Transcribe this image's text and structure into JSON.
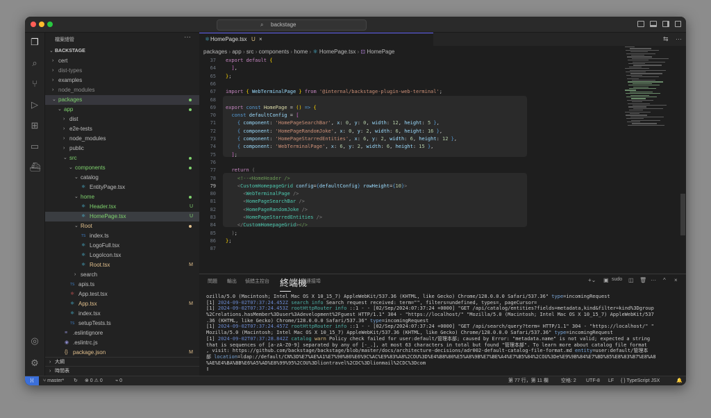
{
  "window": {
    "search_text": "backstage"
  },
  "sidebar": {
    "header": "檔案總管",
    "root": "BACKSTAGE",
    "tree": [
      {
        "label": "cert",
        "depth": 0,
        "chev": "›",
        "icon": "",
        "color": "#bdbdbd"
      },
      {
        "label": "dist-types",
        "depth": 0,
        "chev": "›",
        "icon": "",
        "color": "#8a8a8a"
      },
      {
        "label": "examples",
        "depth": 0,
        "chev": "›",
        "icon": "",
        "color": "#bdbdbd"
      },
      {
        "label": "node_modules",
        "depth": 0,
        "chev": "›",
        "icon": "",
        "color": "#8a8a8a"
      },
      {
        "label": "packages",
        "depth": 0,
        "chev": "⌄",
        "icon": "",
        "color": "#7fd26e",
        "dot": "#7fd26e",
        "selrow": true
      },
      {
        "label": "app",
        "depth": 1,
        "chev": "⌄",
        "icon": "",
        "color": "#7fd26e",
        "dot": "#7fd26e"
      },
      {
        "label": "dist",
        "depth": 2,
        "chev": "›",
        "icon": "",
        "color": "#bdbdbd"
      },
      {
        "label": "e2e-tests",
        "depth": 2,
        "chev": "›",
        "icon": "",
        "color": "#bdbdbd"
      },
      {
        "label": "node_modules",
        "depth": 2,
        "chev": "›",
        "icon": "",
        "color": "#bdbdbd"
      },
      {
        "label": "public",
        "depth": 2,
        "chev": "›",
        "icon": "",
        "color": "#bdbdbd"
      },
      {
        "label": "src",
        "depth": 2,
        "chev": "⌄",
        "icon": "",
        "color": "#7fd26e",
        "dot": "#7fd26e"
      },
      {
        "label": "components",
        "depth": 3,
        "chev": "⌄",
        "icon": "",
        "color": "#7fd26e",
        "dot": "#7fd26e"
      },
      {
        "label": "catalog",
        "depth": 4,
        "chev": "⌄",
        "icon": "",
        "color": "#bdbdbd"
      },
      {
        "label": "EntityPage.tsx",
        "depth": 5,
        "chev": "",
        "icon": "⚛",
        "iconColor": "#4ec1e0",
        "color": "#bdbdbd"
      },
      {
        "label": "home",
        "depth": 4,
        "chev": "⌄",
        "icon": "",
        "color": "#7fd26e",
        "dot": "#7fd26e"
      },
      {
        "label": "Header.tsx",
        "depth": 5,
        "chev": "",
        "icon": "⚛",
        "iconColor": "#4ec1e0",
        "color": "#7fd26e",
        "badge": "U",
        "badgeColor": "#7fd26e"
      },
      {
        "label": "HomePage.tsx",
        "depth": 5,
        "chev": "",
        "icon": "⚛",
        "iconColor": "#4ec1e0",
        "color": "#7fd26e",
        "badge": "U",
        "badgeColor": "#7fd26e",
        "selected": true
      },
      {
        "label": "Root",
        "depth": 4,
        "chev": "⌄",
        "icon": "",
        "color": "#e2c08d",
        "dot": "#e2c08d"
      },
      {
        "label": "index.ts",
        "depth": 5,
        "chev": "",
        "icon": "TS",
        "iconColor": "#3f7fc6",
        "color": "#bdbdbd"
      },
      {
        "label": "LogoFull.tsx",
        "depth": 5,
        "chev": "",
        "icon": "⚛",
        "iconColor": "#4ec1e0",
        "color": "#bdbdbd"
      },
      {
        "label": "LogoIcon.tsx",
        "depth": 5,
        "chev": "",
        "icon": "⚛",
        "iconColor": "#4ec1e0",
        "color": "#bdbdbd"
      },
      {
        "label": "Root.tsx",
        "depth": 5,
        "chev": "",
        "icon": "⚛",
        "iconColor": "#4ec1e0",
        "color": "#e2c08d",
        "badge": "M",
        "badgeColor": "#e2c08d"
      },
      {
        "label": "search",
        "depth": 4,
        "chev": "›",
        "icon": "",
        "color": "#bdbdbd"
      },
      {
        "label": "apis.ts",
        "depth": 3,
        "chev": "",
        "icon": "TS",
        "iconColor": "#3f7fc6",
        "color": "#bdbdbd"
      },
      {
        "label": "App.test.tsx",
        "depth": 3,
        "chev": "",
        "icon": "⚛",
        "iconColor": "#e35d5d",
        "color": "#bdbdbd"
      },
      {
        "label": "App.tsx",
        "depth": 3,
        "chev": "",
        "icon": "⚛",
        "iconColor": "#4ec1e0",
        "color": "#e2c08d",
        "badge": "M",
        "badgeColor": "#e2c08d"
      },
      {
        "label": "index.tsx",
        "depth": 3,
        "chev": "",
        "icon": "⚛",
        "iconColor": "#4ec1e0",
        "color": "#bdbdbd"
      },
      {
        "label": "setupTests.ts",
        "depth": 3,
        "chev": "",
        "icon": "TS",
        "iconColor": "#3f7fc6",
        "color": "#bdbdbd"
      },
      {
        "label": ".eslintignore",
        "depth": 2,
        "chev": "",
        "icon": "≡",
        "iconColor": "#8a8acb",
        "color": "#bdbdbd"
      },
      {
        "label": ".eslintrc.js",
        "depth": 2,
        "chev": "",
        "icon": "◉",
        "iconColor": "#8a8acb",
        "color": "#bdbdbd"
      },
      {
        "label": "package.json",
        "depth": 2,
        "chev": "",
        "icon": "{}",
        "iconColor": "#e2c08d",
        "color": "#e2c08d",
        "badge": "M",
        "badgeColor": "#e2c08d"
      }
    ],
    "outline": "大綱",
    "timeline": "時間表"
  },
  "editor": {
    "tab": {
      "name": "HomePage.tsx",
      "status": "U"
    },
    "breadcrumbs": [
      "packages",
      "app",
      "src",
      "components",
      "home",
      "HomePage.tsx",
      "HomePage"
    ],
    "lines": [
      {
        "n": "37",
        "h": "<span class='kc'>export</span> <span class='kc'>default</span> <span class='br2'>{</span>"
      },
      {
        "n": "64",
        "h": "  <span class='br'>]</span>,"
      },
      {
        "n": "65",
        "h": "<span class='br2'>}</span>;"
      },
      {
        "n": "66",
        "h": ""
      },
      {
        "n": "67",
        "h": "<span class='kc'>import</span> <span class='br2'>{</span> <span class='v'>WebTerminalPage</span> <span class='br2'>}</span> <span class='kc'>from</span> <span class='s'>'@internal/backstage-plugin-web-terminal'</span>;"
      },
      {
        "n": "68",
        "h": ""
      },
      {
        "n": "69",
        "h": "<span class='kc'>export</span> <span class='k'>const</span> <span class='fn'>HomePage</span> = <span class='br2'>()</span> <span class='k'>=&gt;</span> <span class='br2'>{</span>"
      },
      {
        "n": "70",
        "h": "  <span class='k'>const</span> <span class='v'>defaultConfig</span> = <span class='br'>[</span>"
      },
      {
        "n": "71",
        "h": "    <span class='k'>{</span> <span class='v'>component</span>: <span class='s'>'HomePageSearchBar'</span>, <span class='v'>x</span>: <span class='n'>0</span>, <span class='v'>y</span>: <span class='n'>0</span>, <span class='v'>width</span>: <span class='n'>12</span>, <span class='v'>height</span>: <span class='n'>5</span> <span class='k'>}</span>,"
      },
      {
        "n": "72",
        "h": "    <span class='k'>{</span> <span class='v'>component</span>: <span class='s'>'HomePageRandomJoke'</span>, <span class='v'>x</span>: <span class='n'>0</span>, <span class='v'>y</span>: <span class='n'>2</span>, <span class='v'>width</span>: <span class='n'>6</span>, <span class='v'>height</span>: <span class='n'>16</span> <span class='k'>}</span>,"
      },
      {
        "n": "73",
        "h": "    <span class='k'>{</span> <span class='v'>component</span>: <span class='s'>'HomePageStarredEntities'</span>, <span class='v'>x</span>: <span class='n'>6</span>, <span class='v'>y</span>: <span class='n'>2</span>, <span class='v'>width</span>: <span class='n'>6</span>, <span class='v'>height</span>: <span class='n'>12</span> <span class='k'>}</span>,"
      },
      {
        "n": "74",
        "h": "    <span class='k'>{</span> <span class='v'>component</span>: <span class='s'>'WebTerminalPage'</span>, <span class='v'>x</span>: <span class='n'>6</span>, <span class='v'>y</span>: <span class='n'>2</span>, <span class='v'>width</span>: <span class='n'>6</span>, <span class='v'>height</span>: <span class='n'>15</span> <span class='k'>}</span>,"
      },
      {
        "n": "75",
        "h": "  <span class='br'>]</span>;"
      },
      {
        "n": "76",
        "h": ""
      },
      {
        "n": "77",
        "h": "  <span class='kc'>return</span> <span class='g'>(</span>"
      },
      {
        "n": "78",
        "h": "    <span class='cm'>&lt;!--&lt;HomeHeader /&gt;</span>"
      },
      {
        "n": "79",
        "h": "    <span class='g'>&lt;</span><span class='tg'>CustomHomepageGrid</span> <span class='v'>config</span>=<span class='k'>{</span><span class='v'>defaultConfig</span><span class='k'>}</span> <span class='v'>rowHeight</span>=<span class='k'>{</span><span class='n'>10</span><span class='k'>}</span><span class='g'>&gt;</span>",
        "cur": true
      },
      {
        "n": "80",
        "h": "      <span class='g'>&lt;</span><span class='tg'>WebTerminalPage</span> <span class='g'>/&gt;</span>"
      },
      {
        "n": "81",
        "h": "      <span class='g'>&lt;</span><span class='tg'>HomePageSearchBar</span> <span class='g'>/&gt;</span>"
      },
      {
        "n": "82",
        "h": "      <span class='g'>&lt;</span><span class='tg'>HomePageRandomJoke</span> <span class='g'>/&gt;</span>"
      },
      {
        "n": "83",
        "h": "      <span class='g'>&lt;</span><span class='tg'>HomePageStarredEntities</span> <span class='g'>/&gt;</span>"
      },
      {
        "n": "84",
        "h": "    <span class='g'>&lt;/</span><span class='tg'>CustomHomepageGrid</span><span class='g'>&gt;</span><span class='cm'>&lt;/&gt;</span>"
      },
      {
        "n": "85",
        "h": "  <span class='g'>)</span>;"
      },
      {
        "n": "86",
        "h": "<span class='br2'>}</span>;"
      },
      {
        "n": "87",
        "h": ""
      }
    ]
  },
  "panel": {
    "tabs": [
      "問題",
      "輸出",
      "偵錯主控台",
      "終端機",
      "連接埠"
    ],
    "active": "終端機",
    "term_label": "sudo",
    "terminal": [
      "ozilla/5.0 (Macintosh; Intel Mac OS X 10_15_7) AppleWebKit/537.36 (KHTML, like Gecko) Chrome/128.0.0.0 Safari/537.36\" <span class='t-key'>type</span>=incomingRequest",
      "[1] <span class='t-date'>2024-09-02T07:37:24.452Z</span> <span class='t-cat'>search</span> <span class='t-info'>info</span> Search request received: term=\"\", filters=undefined, types=, pageCursor=",
      "[1] <span class='t-date'>2024-09-02T07:37:24.453Z</span> <span class='t-cat'>rootHttpRouter</span> <span class='t-info'>info</span> ::1 - - [02/Sep/2024:07:37:24 +0000] \"GET /api/catalog/entities?fields=metadata,kind&amp;filter=kind%3Dgroup",
      "%2Crelations.hasMember%3Duser%3Adevelopment%2Fguest HTTP/1.1\" 304 - \"https://localhost/\" \"Mozilla/5.0 (Macintosh; Intel Mac OS X 10_15_7) AppleWebKit/537",
      ".36 (KHTML, like Gecko) Chrome/128.0.0.0 Safari/537.36\" <span class='t-key'>type</span>=incomingRequest",
      "[1] <span class='t-date'>2024-09-02T07:37:24.457Z</span> <span class='t-cat'>rootHttpRouter</span> <span class='t-info'>info</span> ::1 - - [02/Sep/2024:07:37:24 +0000] \"GET /api/search/query?term= HTTP/1.1\" 304 - \"https://localhost/\" \"",
      "Mozilla/5.0 (Macintosh; Intel Mac OS X 10_15_7) AppleWebKit/537.36 (KHTML, like Gecko) Chrome/128.0.0.0 Safari/537.36\" <span class='t-key'>type</span>=incomingRequest",
      "[1] <span class='t-date'>2024-09-02T07:37:28.842Z</span> <span class='t-cat'>catalog</span> <span class='t-warn'>warn</span> Policy check failed for user:default/管理本部; caused by Error: \"metadata.name\" is not valid; expected a string",
      " that is sequences of [a-zA-Z0-9] separated by any of [-_.], at most 63 characters in total but found \"管理本部\". To learn more about catalog file format",
      ", visit: https://github.com/backstage/backstage/blob/master/docs/architecture-decisions/adr002-default-catalog-file-format.md <span class='t-key'>entity</span>=user:default/管理本",
      "部 <span class='t-key'>location</span>=ldap://default/CN%3D%E7%AE%A1%E7%90%86%E6%9C%AC%E9%83%A8%2COU%3D%E4%B8%80%E5%A8%9B%E7%BE%A4%E7%B5%84%2COU%3De%E9%9B%84%E7%BD%85%E8%83%B7%E8%A8",
      "%AE%E4%BA%BB%E6%A5%AD%E8%99%95%2COU%3Dliontravel%2CDC%3Dlionmail%2CDC%3Dcom",
      "▯"
    ]
  },
  "status": {
    "branch": "master*",
    "sync": "↻",
    "errors": "⊗ 0 ⚠ 0",
    "ports": "⌁ 0",
    "position": "第 77 行，第 11 欄",
    "spaces": "空格: 2",
    "encoding": "UTF-8",
    "eol": "LF",
    "language": "{ } TypeScript JSX"
  }
}
